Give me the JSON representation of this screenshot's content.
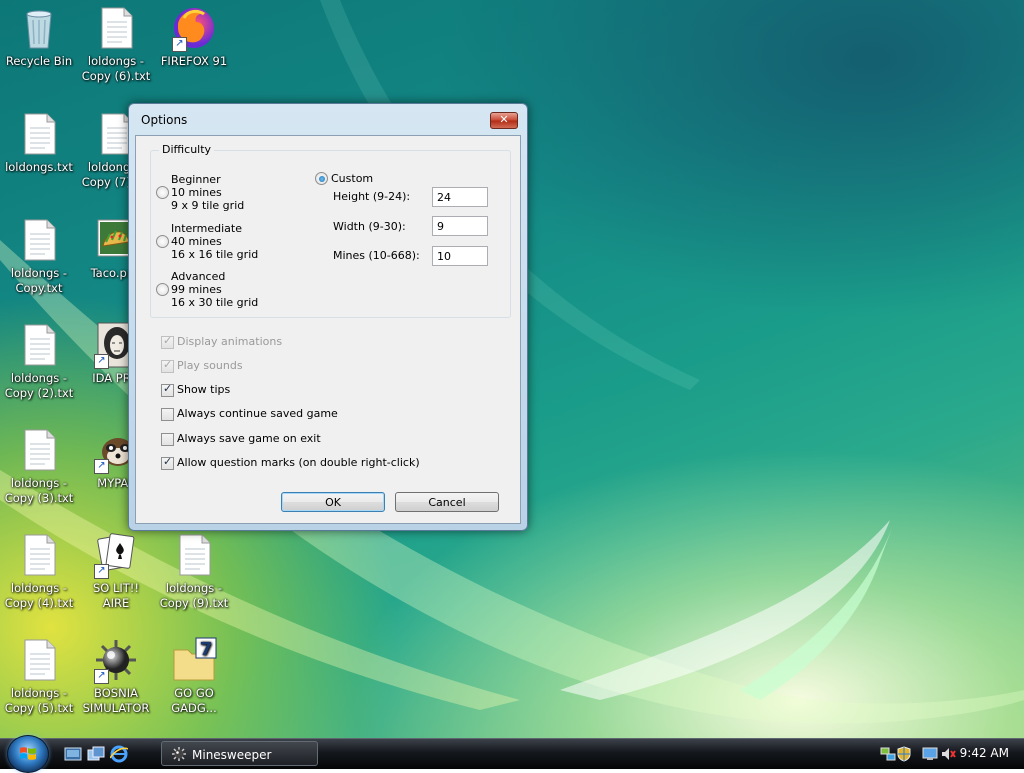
{
  "desktop": {
    "icons": [
      {
        "label": "Recycle Bin"
      },
      {
        "label": "loldongs - Copy (6).txt"
      },
      {
        "label": "FIREFOX 91"
      },
      {
        "label": "loldongs.txt"
      },
      {
        "label": "loldongs - Copy (7).txt"
      },
      {
        "label": "loldongs - Copy.txt"
      },
      {
        "label": "Taco.png"
      },
      {
        "label": "loldongs - Copy (2).txt"
      },
      {
        "label": "IDA PRO"
      },
      {
        "label": "loldongs - Copy (3).txt"
      },
      {
        "label": "MYPAL"
      },
      {
        "label": "loldongs - Copy (4).txt"
      },
      {
        "label": "SO LIT!! AIRE"
      },
      {
        "label": "loldongs - Copy (9).txt"
      },
      {
        "label": "loldongs - Copy (5).txt"
      },
      {
        "label": "BOSNIA SIMULATOR"
      },
      {
        "label": "GO GO GADG..."
      }
    ]
  },
  "dialog": {
    "title": "Options",
    "close_glyph": "✕",
    "difficulty": {
      "group_label": "Difficulty",
      "options": [
        {
          "name": "Beginner",
          "mines": "10 mines",
          "grid": "9 x 9 tile grid",
          "selected": false
        },
        {
          "name": "Intermediate",
          "mines": "40 mines",
          "grid": "16 x 16 tile grid",
          "selected": false
        },
        {
          "name": "Advanced",
          "mines": "99 mines",
          "grid": "16 x 30 tile grid",
          "selected": false
        }
      ],
      "custom": {
        "label": "Custom",
        "selected": true,
        "height_label": "Height (9-24):",
        "height_value": "24",
        "width_label": "Width (9-30):",
        "width_value": "9",
        "mines_label": "Mines (10-668):",
        "mines_value": "10"
      }
    },
    "checkboxes": [
      {
        "label": "Display animations",
        "checked": true,
        "disabled": true
      },
      {
        "label": "Play sounds",
        "checked": true,
        "disabled": true
      },
      {
        "label": "Show tips",
        "checked": true,
        "disabled": false
      },
      {
        "label": "Always continue saved game",
        "checked": false,
        "disabled": false
      },
      {
        "label": "Always save game on exit",
        "checked": false,
        "disabled": false
      },
      {
        "label": "Allow question marks (on double right-click)",
        "checked": true,
        "disabled": false
      }
    ],
    "ok_label": "OK",
    "cancel_label": "Cancel"
  },
  "taskbar": {
    "task_label": "Minesweeper",
    "clock": "9:42 AM"
  }
}
